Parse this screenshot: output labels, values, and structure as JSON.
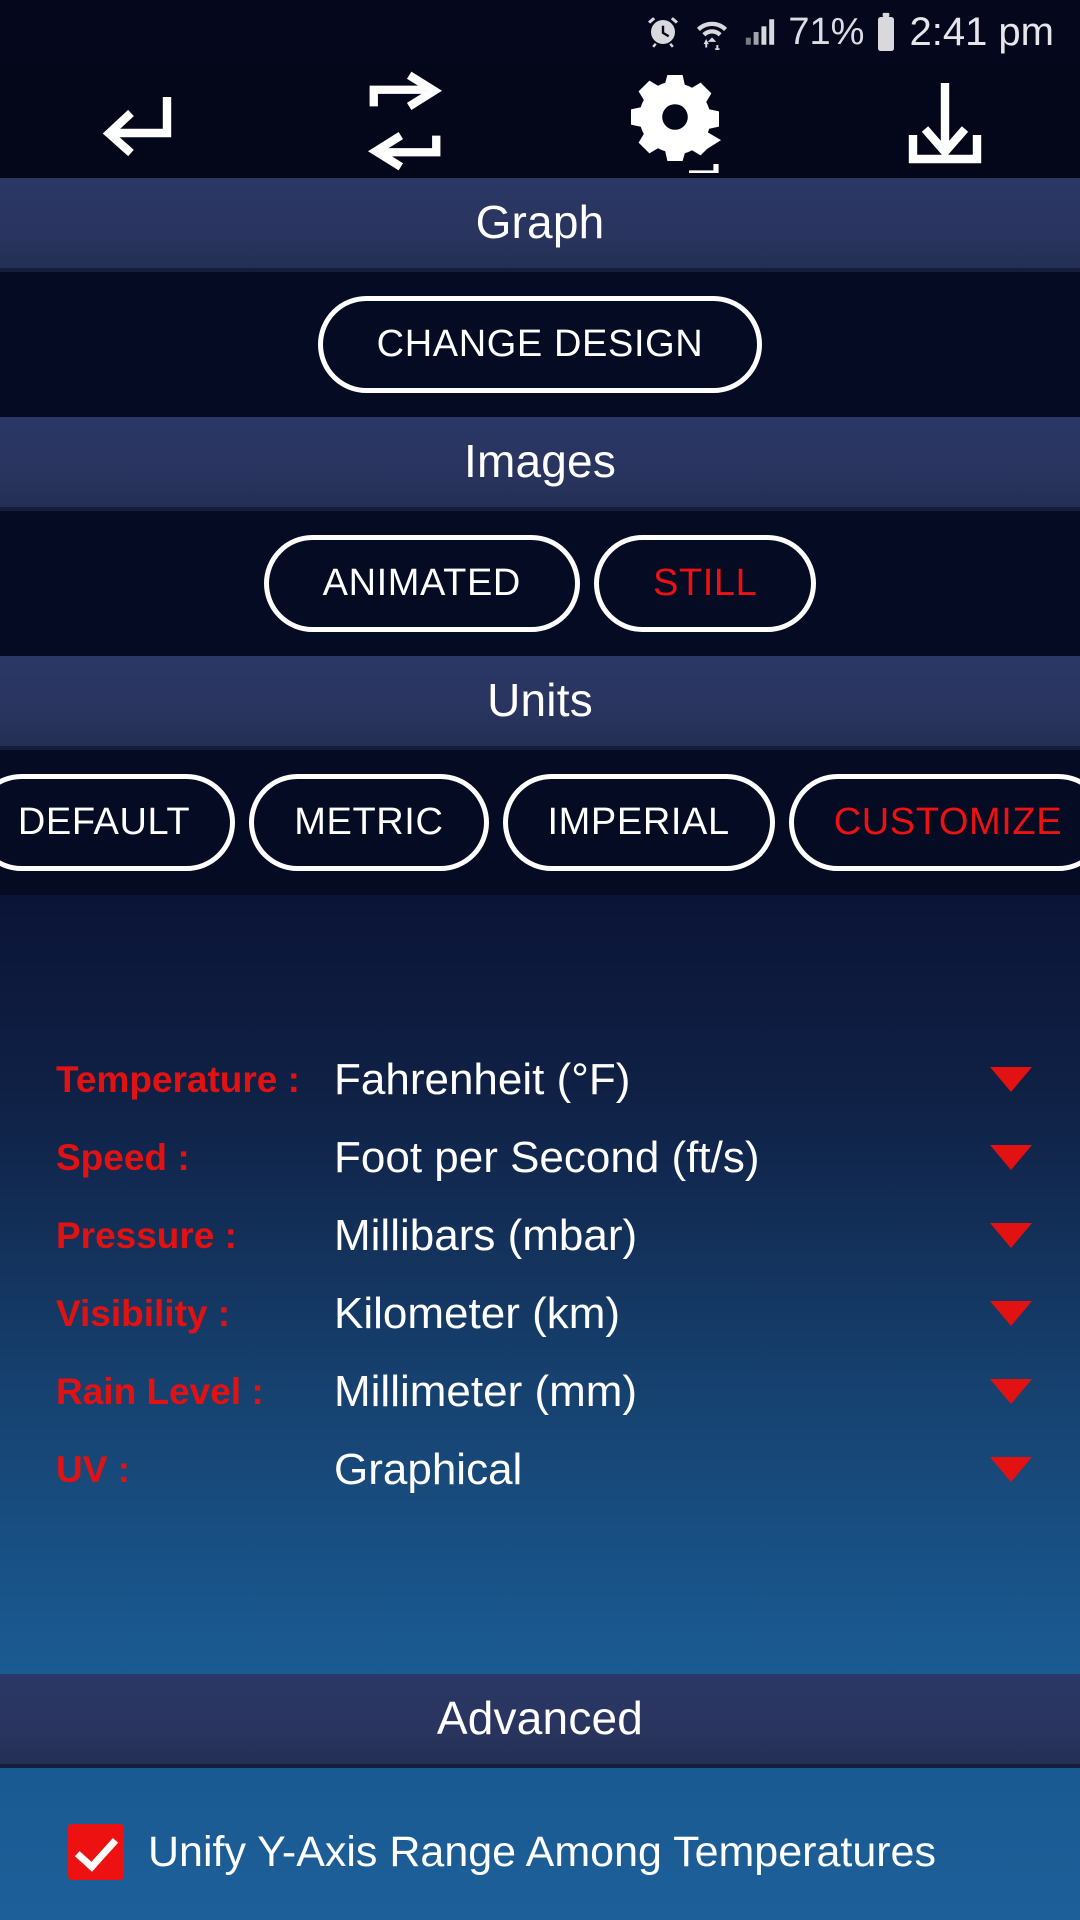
{
  "statusbar": {
    "icons": [
      "alarm-icon",
      "wifi-icon",
      "signal-icon",
      "battery-icon"
    ],
    "battery_percent": "71%",
    "time": "2:41 pm"
  },
  "toolbar": {
    "items": [
      {
        "name": "back-icon",
        "label": "Back"
      },
      {
        "name": "swap-icon",
        "label": "Swap"
      },
      {
        "name": "settings-swap-icon",
        "label": "Settings"
      },
      {
        "name": "download-icon",
        "label": "Download"
      }
    ]
  },
  "sections": {
    "graph": {
      "title": "Graph",
      "change_design_label": "CHANGE DESIGN"
    },
    "images": {
      "title": "Images",
      "options": [
        {
          "label": "ANIMATED",
          "selected": false
        },
        {
          "label": "STILL",
          "selected": true
        }
      ]
    },
    "units": {
      "title": "Units",
      "options": [
        {
          "label": "DEFAULT",
          "selected": false
        },
        {
          "label": "METRIC",
          "selected": false
        },
        {
          "label": "IMPERIAL",
          "selected": false
        },
        {
          "label": "CUSTOMIZE",
          "selected": true
        }
      ],
      "rows": [
        {
          "label": "Temperature :",
          "value": "Fahrenheit (°F)"
        },
        {
          "label": "Speed :",
          "value": "Foot per Second (ft/s)"
        },
        {
          "label": "Pressure :",
          "value": "Millibars (mbar)"
        },
        {
          "label": "Visibility :",
          "value": "Kilometer (km)"
        },
        {
          "label": "Rain Level :",
          "value": "Millimeter (mm)"
        },
        {
          "label": "UV :",
          "value": "Graphical"
        }
      ]
    },
    "advanced": {
      "title": "Advanced",
      "checkbox": {
        "label": "Unify Y-Axis Range Among Temperatures",
        "checked": true
      }
    }
  },
  "colors": {
    "accent_red": "#ee1111",
    "header_band": "#2b3765",
    "dark_navy": "#060b24",
    "bottom_blue": "#1a5b93"
  }
}
